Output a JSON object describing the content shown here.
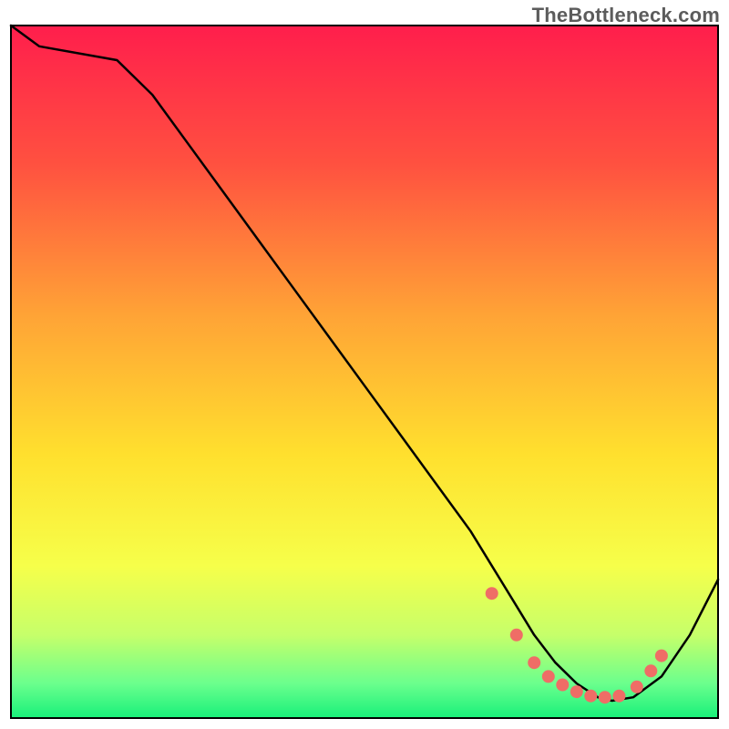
{
  "watermark": "TheBottleneck.com",
  "chart_data": {
    "type": "line",
    "title": "",
    "xlabel": "",
    "ylabel": "",
    "xlim": [
      0,
      100
    ],
    "ylim": [
      0,
      100
    ],
    "series": [
      {
        "name": "curve",
        "x": [
          0,
          4,
          15,
          20,
          25,
          30,
          35,
          40,
          45,
          50,
          55,
          60,
          65,
          68,
          71,
          74,
          77,
          80,
          83,
          85,
          88,
          92,
          96,
          100
        ],
        "y": [
          100,
          97,
          95,
          90,
          83,
          76,
          69,
          62,
          55,
          48,
          41,
          34,
          27,
          22,
          17,
          12,
          8,
          5,
          3,
          2.5,
          3,
          6,
          12,
          20
        ]
      }
    ],
    "markers": {
      "name": "highlight-dots",
      "x": [
        68,
        71.5,
        74,
        76,
        78,
        80,
        82,
        84,
        86,
        88.5,
        90.5,
        92
      ],
      "y": [
        18,
        12,
        8,
        6,
        4.8,
        3.8,
        3.2,
        3.0,
        3.2,
        4.5,
        6.8,
        9
      ]
    },
    "gradient_stops": [
      {
        "offset": 0.0,
        "color": "#ff1e4c"
      },
      {
        "offset": 0.2,
        "color": "#ff5140"
      },
      {
        "offset": 0.42,
        "color": "#ffa436"
      },
      {
        "offset": 0.62,
        "color": "#ffe02e"
      },
      {
        "offset": 0.78,
        "color": "#f6ff4a"
      },
      {
        "offset": 0.88,
        "color": "#c6ff6a"
      },
      {
        "offset": 0.95,
        "color": "#6bff8d"
      },
      {
        "offset": 1.0,
        "color": "#18f07a"
      }
    ],
    "legend": null,
    "grid": false
  }
}
